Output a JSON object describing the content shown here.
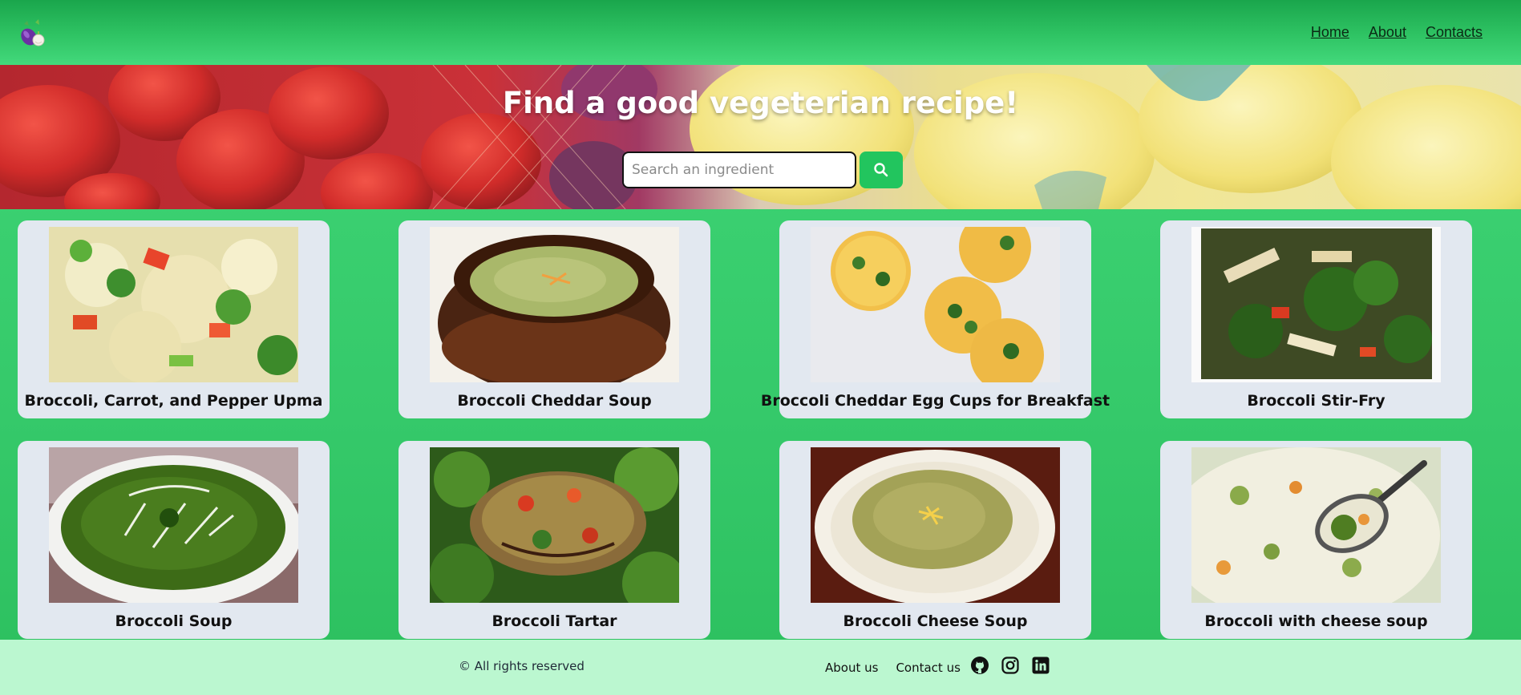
{
  "header": {
    "logo_icon": "eggplant-garlic-logo",
    "nav": [
      {
        "label": "Home"
      },
      {
        "label": "About"
      },
      {
        "label": "Contacts"
      }
    ]
  },
  "hero": {
    "title": "Find a good vegeterian recipe!",
    "search": {
      "placeholder": "Search an ingredient",
      "value": "",
      "button_icon": "search-icon",
      "button_color": "#22c55e"
    }
  },
  "recipes": [
    {
      "title": "Broccoli, Carrot, and Pepper Upma",
      "image": "upma-photo"
    },
    {
      "title": "Broccoli Cheddar Soup",
      "image": "cheddar-soup-pot-photo"
    },
    {
      "title": "Broccoli Cheddar Egg Cups for Breakfast",
      "image": "egg-cups-photo"
    },
    {
      "title": "Broccoli Stir-Fry",
      "image": "stir-fry-photo"
    },
    {
      "title": "Broccoli Soup",
      "image": "green-soup-bowl-photo"
    },
    {
      "title": "Broccoli Tartar",
      "image": "tartar-photo"
    },
    {
      "title": "Broccoli Cheese Soup",
      "image": "cheese-soup-plate-photo"
    },
    {
      "title": "Broccoli with cheese soup",
      "image": "cheese-soup-spoon-photo"
    }
  ],
  "footer": {
    "copyright": "© All rights reserved",
    "links": [
      {
        "label": "About us"
      },
      {
        "label": "Contact us"
      }
    ],
    "socials": [
      "github-icon",
      "instagram-icon",
      "linkedin-icon"
    ]
  },
  "colors": {
    "page_green": "#3fd676",
    "card_bg": "#e2e8f0",
    "footer_bg": "#bbf7d0"
  }
}
